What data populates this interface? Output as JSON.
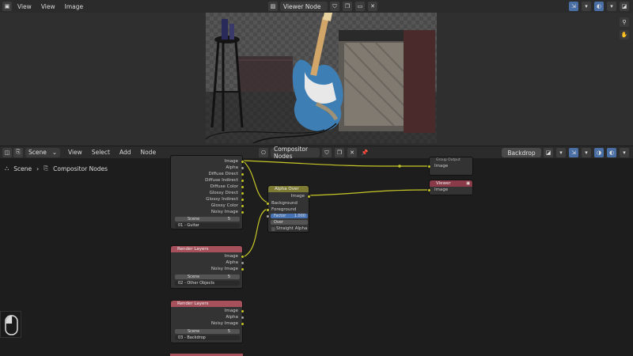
{
  "image_editor": {
    "menus": [
      "View",
      "View",
      "Image"
    ],
    "image_name": "Viewer Node"
  },
  "node_editor": {
    "scene_label": "Scene",
    "menus": [
      "View",
      "Select",
      "Add",
      "Node"
    ],
    "tree_name": "Compositor Nodes",
    "backdrop_label": "Backdrop",
    "breadcrumb": {
      "scene": "Scene",
      "tree": "Compositor Nodes"
    }
  },
  "nodes": {
    "render1": {
      "outputs": [
        "Image",
        "Alpha",
        "Diffuse Direct",
        "Diffuse Indirect",
        "Diffuse Color",
        "Glossy Direct",
        "Glossy Indirect",
        "Glossy Color",
        "Noisy Image"
      ],
      "scene": "Scene",
      "layer": "01 - Guitar",
      "count": "5"
    },
    "render2": {
      "title": "Render Layers",
      "outputs": [
        "Image",
        "Alpha",
        "Noisy Image"
      ],
      "scene": "Scene",
      "layer": "02 - Other Objects",
      "count": "5"
    },
    "render3": {
      "title": "Render Layers",
      "outputs": [
        "Image",
        "Alpha",
        "Noisy Image"
      ],
      "scene": "Scene",
      "layer": "03 - Backdrop",
      "count": "5"
    },
    "alpha_over": {
      "title": "Alpha Over",
      "output": "Image",
      "inputs": [
        "Background",
        "Foreground"
      ],
      "factor_label": "Factor",
      "factor_value": "1.000",
      "mode": "Over",
      "straight_alpha": "Straight Alpha"
    },
    "group_output": {
      "title": "Group Output",
      "input": "Image"
    },
    "viewer": {
      "title": "Viewer",
      "input": "Image"
    }
  },
  "colors": {
    "render_header": "#a5505a",
    "alpha_header": "#7d7a33",
    "viewer_header": "#8a3a48",
    "link": "#c7c729"
  }
}
